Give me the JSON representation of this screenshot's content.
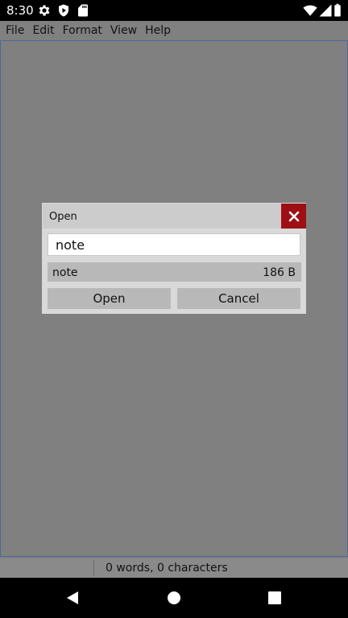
{
  "status_bar": {
    "time": "8:30",
    "left_icons": [
      "gear-icon",
      "shield-play-icon",
      "sd-card-icon"
    ],
    "right_icons": [
      "wifi-icon",
      "cellular-signal-icon",
      "battery-icon"
    ]
  },
  "menu": {
    "items": [
      {
        "label": "File"
      },
      {
        "label": "Edit"
      },
      {
        "label": "Format"
      },
      {
        "label": "View"
      },
      {
        "label": "Help"
      }
    ]
  },
  "footer": {
    "stats": "0 words, 0 characters"
  },
  "dialog": {
    "title": "Open",
    "close_icon": "close-icon",
    "filename_value": "note",
    "files": [
      {
        "name": "note",
        "size": "186 B"
      }
    ],
    "open_label": "Open",
    "cancel_label": "Cancel"
  },
  "nav_bar": {
    "buttons": [
      "back-icon",
      "home-icon",
      "recents-icon"
    ]
  },
  "colors": {
    "background": "#808080",
    "close_button": "#9e0f14",
    "dialog_header": "#cccccc",
    "dialog_body": "#d9d9d9",
    "button": "#b8b8b8",
    "editor_border": "#4a6a9a"
  }
}
